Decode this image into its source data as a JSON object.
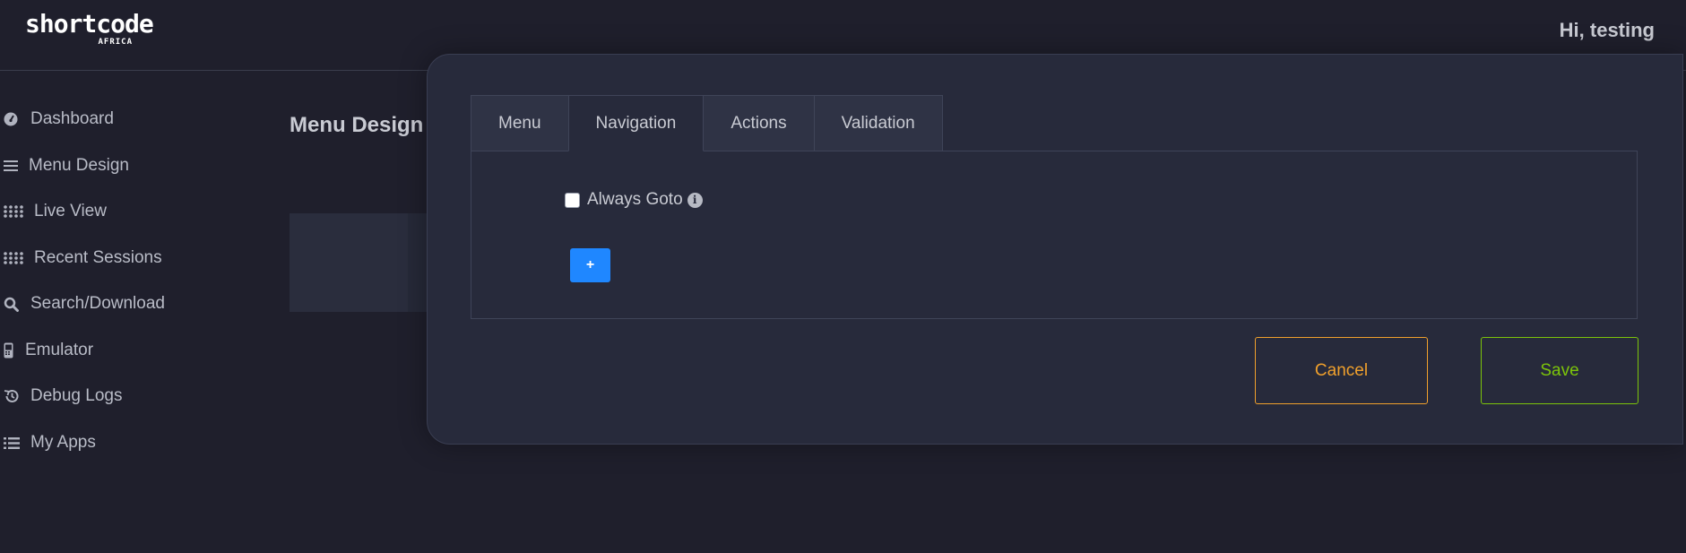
{
  "header": {
    "logo_main": "shortcode",
    "logo_sub": "AFRICA",
    "greeting": "Hi, testing"
  },
  "sidebar": {
    "items": [
      {
        "label": "Dashboard",
        "icon": "dashboard-icon"
      },
      {
        "label": "Menu Design",
        "icon": "bars-icon"
      },
      {
        "label": "Live View",
        "icon": "grid-dots-icon"
      },
      {
        "label": "Recent Sessions",
        "icon": "grid-dots-icon"
      },
      {
        "label": "Search/Download",
        "icon": "search-icon"
      },
      {
        "label": "Emulator",
        "icon": "phone-icon"
      },
      {
        "label": "Debug Logs",
        "icon": "history-icon"
      },
      {
        "label": "My Apps",
        "icon": "list-icon"
      }
    ]
  },
  "main": {
    "page_title": "Menu Design V"
  },
  "modal": {
    "tabs": [
      {
        "label": "Menu"
      },
      {
        "label": "Navigation",
        "active": true
      },
      {
        "label": "Actions"
      },
      {
        "label": "Validation"
      }
    ],
    "always_goto_label": "Always Goto",
    "always_goto_checked": false,
    "info_symbol": "i",
    "add_label": "+",
    "cancel_label": "Cancel",
    "save_label": "Save"
  },
  "colors": {
    "background": "#1f1f2c",
    "modal": "#272a3b",
    "primary": "#1f87ff",
    "cancel": "#f0a02c",
    "save": "#7cc40a"
  }
}
